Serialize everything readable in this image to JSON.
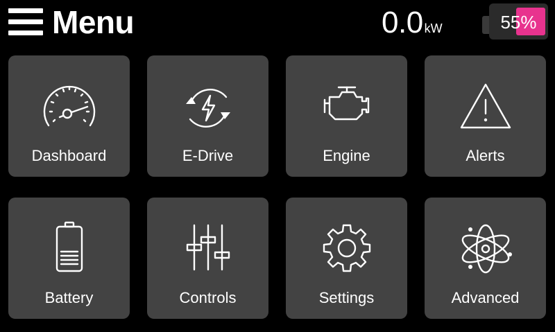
{
  "header": {
    "menu_icon": "hamburger-icon",
    "title": "Menu",
    "power": {
      "value": "0.0",
      "unit": "kW"
    },
    "battery": {
      "level_percent": 55,
      "text": "55%",
      "accent_color": "#e8338e"
    }
  },
  "tiles": [
    {
      "label": "Dashboard",
      "icon": "speedometer-icon"
    },
    {
      "label": "E-Drive",
      "icon": "e-drive-icon"
    },
    {
      "label": "Engine",
      "icon": "engine-icon"
    },
    {
      "label": "Alerts",
      "icon": "warning-icon"
    },
    {
      "label": "Battery",
      "icon": "battery-icon"
    },
    {
      "label": "Controls",
      "icon": "sliders-icon"
    },
    {
      "label": "Settings",
      "icon": "gear-icon"
    },
    {
      "label": "Advanced",
      "icon": "atom-icon"
    }
  ],
  "colors": {
    "background": "#000000",
    "tile": "#434343",
    "text": "#ffffff",
    "accent": "#e8338e"
  }
}
